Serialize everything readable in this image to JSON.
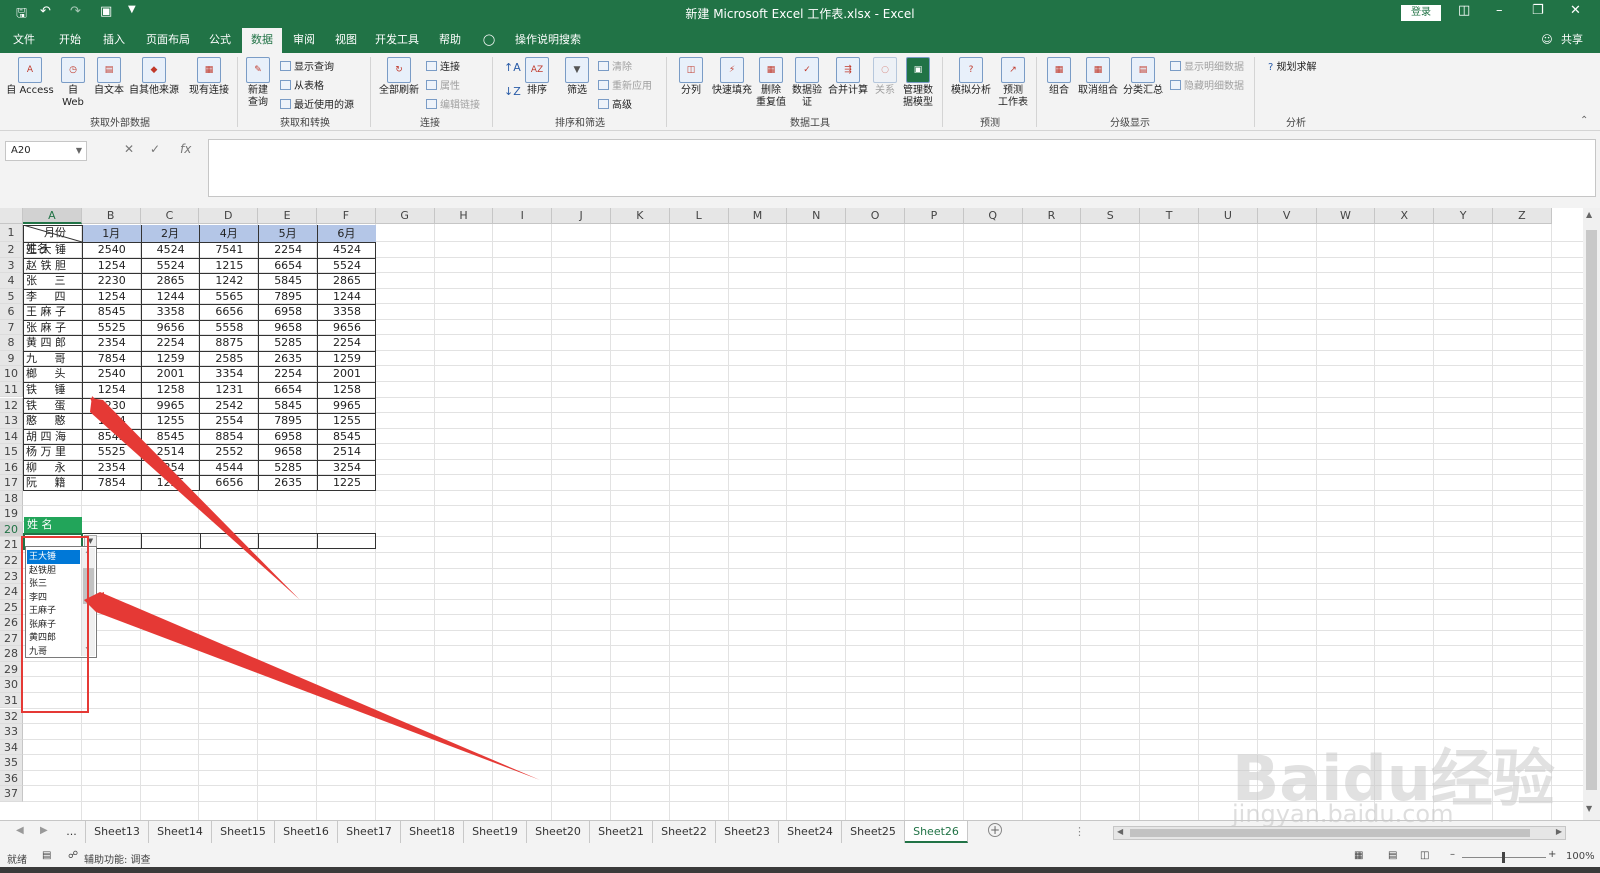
{
  "title_bar": {
    "title": "新建 Microsoft Excel 工作表.xlsx  -  Excel",
    "login": "登录",
    "quick_access": [
      "save-icon",
      "undo-icon",
      "redo-icon",
      "touch-icon",
      "customize-icon"
    ]
  },
  "ribbon_tabs": [
    "文件",
    "开始",
    "插入",
    "页面布局",
    "公式",
    "数据",
    "审阅",
    "视图",
    "开发工具",
    "帮助",
    "操作说明搜索"
  ],
  "active_tab": "数据",
  "share": "共享",
  "ribbon": {
    "g1": {
      "label": "获取外部数据",
      "buttons": [
        "自 Access",
        "自\nWeb",
        "自文本",
        "自其他来源",
        "现有连接"
      ]
    },
    "g2": {
      "label": "获取和转换",
      "big": "新建\n查询",
      "small": [
        "显示查询",
        "从表格",
        "最近使用的源"
      ]
    },
    "g3": {
      "label": "连接",
      "big": "全部刷新",
      "small": [
        "连接",
        "属性",
        "编辑链接"
      ]
    },
    "g4": {
      "label": "排序和筛选",
      "sort": "排序",
      "filter": "筛选",
      "small": [
        "清除",
        "重新应用",
        "高级"
      ]
    },
    "g5": {
      "label": "数据工具",
      "buttons": [
        "分列",
        "快速填充",
        "删除\n重复值",
        "数据验\n证",
        "合并计算",
        "关系",
        "管理数\n据模型"
      ]
    },
    "g6": {
      "label": "预测",
      "buttons": [
        "模拟分析",
        "预测\n工作表"
      ]
    },
    "g7": {
      "label": "分级显示",
      "buttons": [
        "组合",
        "取消组合",
        "分类汇总"
      ],
      "small": [
        "显示明细数据",
        "隐藏明细数据"
      ]
    },
    "g8": {
      "label": "分析",
      "buttons": [
        "规划求解"
      ]
    }
  },
  "formula_bar": {
    "name_box": "A20",
    "formula": ""
  },
  "columns": [
    "A",
    "B",
    "C",
    "D",
    "E",
    "F",
    "G",
    "H",
    "I",
    "J",
    "K",
    "L",
    "M",
    "N",
    "O",
    "P",
    "Q",
    "R",
    "S",
    "T",
    "U",
    "V",
    "W",
    "X",
    "Y",
    "Z"
  ],
  "selected_column": "A",
  "selected_row": "20",
  "rows": [
    "1",
    "2",
    "3",
    "4",
    "5",
    "6",
    "7",
    "8",
    "9",
    "10",
    "11",
    "12",
    "13",
    "14",
    "15",
    "16",
    "17",
    "18",
    "19",
    "20",
    "21",
    "22",
    "23",
    "24",
    "25",
    "26",
    "27",
    "28",
    "29",
    "30",
    "31",
    "32",
    "33",
    "34",
    "35",
    "36",
    "37"
  ],
  "table": {
    "corner_top": "月份",
    "corner_bottom": "姓名",
    "months": [
      "1月",
      "2月",
      "4月",
      "5月",
      "6月"
    ],
    "data": [
      {
        "name": "王 大 锤",
        "values": [
          "2540",
          "4524",
          "7541",
          "2254",
          "4524"
        ]
      },
      {
        "name": "赵 铁 胆",
        "values": [
          "1254",
          "5524",
          "1215",
          "6654",
          "5524"
        ]
      },
      {
        "name": "张     三",
        "values": [
          "2230",
          "2865",
          "1242",
          "5845",
          "2865"
        ]
      },
      {
        "name": "李     四",
        "values": [
          "1254",
          "1244",
          "5565",
          "7895",
          "1244"
        ]
      },
      {
        "name": "王 麻 子",
        "values": [
          "8545",
          "3358",
          "6656",
          "6958",
          "3358"
        ]
      },
      {
        "name": "张 麻 子",
        "values": [
          "5525",
          "9656",
          "5558",
          "9658",
          "9656"
        ]
      },
      {
        "name": "黄 四 郎",
        "values": [
          "2354",
          "2254",
          "8875",
          "5285",
          "2254"
        ]
      },
      {
        "name": "九     哥",
        "values": [
          "7854",
          "1259",
          "2585",
          "2635",
          "1259"
        ]
      },
      {
        "name": "榔     头",
        "values": [
          "2540",
          "2001",
          "3354",
          "2254",
          "2001"
        ]
      },
      {
        "name": "铁     锤",
        "values": [
          "1254",
          "1258",
          "1231",
          "6654",
          "1258"
        ]
      },
      {
        "name": "铁     蛋",
        "values": [
          "2230",
          "9965",
          "2542",
          "5845",
          "9965"
        ]
      },
      {
        "name": "憨     憨",
        "values": [
          "1254",
          "1255",
          "2554",
          "7895",
          "1255"
        ]
      },
      {
        "name": "胡 四 海",
        "values": [
          "8545",
          "8545",
          "8854",
          "6958",
          "8545"
        ]
      },
      {
        "name": "杨 万 里",
        "values": [
          "5525",
          "2514",
          "2552",
          "9658",
          "2514"
        ]
      },
      {
        "name": "柳     永",
        "values": [
          "2354",
          "3254",
          "4544",
          "5285",
          "3254"
        ]
      },
      {
        "name": "阮     籍",
        "values": [
          "7854",
          "1225",
          "6656",
          "2635",
          "1225"
        ]
      }
    ]
  },
  "lookup_header": "姓     名",
  "dropdown_items": [
    "王大锤",
    "赵铁胆",
    "张三",
    "李四",
    "王麻子",
    "张麻子",
    "黄四郎",
    "九哥"
  ],
  "dropdown_selected": "王大锤",
  "sheets": [
    "...",
    "Sheet13",
    "Sheet14",
    "Sheet15",
    "Sheet16",
    "Sheet17",
    "Sheet18",
    "Sheet19",
    "Sheet20",
    "Sheet21",
    "Sheet22",
    "Sheet23",
    "Sheet24",
    "Sheet25",
    "Sheet26"
  ],
  "active_sheet": "Sheet26",
  "status": {
    "ready": "就绪",
    "accessibility": "辅助功能: 调查",
    "zoom": "100%"
  },
  "watermark": {
    "brand": "Baidu经验",
    "url": "jingyan.baidu.com"
  },
  "colors": {
    "excel_green": "#217346",
    "header_blue": "#b4c6e7",
    "annotation_red": "#e53935",
    "selection_blue": "#0078d7"
  }
}
